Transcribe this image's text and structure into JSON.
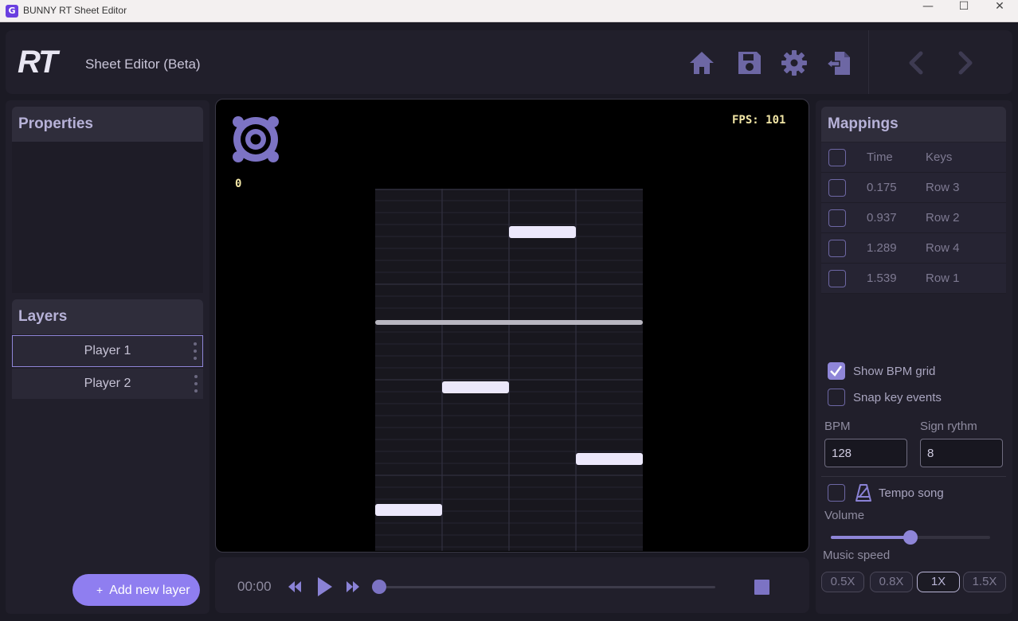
{
  "window": {
    "title": "BUNNY RT Sheet Editor",
    "icon_glyph": "G",
    "controls": {
      "minimize": "—",
      "maximize": "☐",
      "close": "✕"
    }
  },
  "header": {
    "logo": "RT",
    "subtitle": "Sheet Editor (Beta)",
    "icons": [
      "home-icon",
      "save-icon",
      "gear-icon",
      "export-icon",
      "undo-icon",
      "redo-icon"
    ],
    "accent": "#6d67a4"
  },
  "properties": {
    "title": "Properties"
  },
  "layers": {
    "title": "Layers",
    "items": [
      {
        "label": "Player 1",
        "selected": true
      },
      {
        "label": "Player 2",
        "selected": false
      }
    ],
    "add_label": "Add new layer",
    "add_icon": "+"
  },
  "canvas": {
    "fps_label": "FPS: 101",
    "score": "0",
    "lane_count": 4,
    "notes": [
      {
        "time": 0.175,
        "row": 3
      },
      {
        "time": 0.937,
        "row": 2
      },
      {
        "time": 1.289,
        "row": 4
      },
      {
        "time": 1.539,
        "row": 1
      }
    ]
  },
  "transport": {
    "time": "00:00",
    "progress": 0
  },
  "mappings": {
    "title": "Mappings",
    "col_time": "Time",
    "col_keys": "Keys",
    "rows": [
      {
        "time": "0.175",
        "keys": "Row 3"
      },
      {
        "time": "0.937",
        "keys": "Row 2"
      },
      {
        "time": "1.289",
        "keys": "Row 4"
      },
      {
        "time": "1.539",
        "keys": "Row 1"
      }
    ]
  },
  "settings": {
    "show_bpm_grid": {
      "label": "Show BPM grid",
      "checked": true
    },
    "snap_key_events": {
      "label": "Snap key events",
      "checked": false
    },
    "bpm": {
      "label": "BPM",
      "value": "128"
    },
    "sign_rythm": {
      "label": "Sign rythm",
      "value": "8"
    },
    "tempo_song": {
      "label": "Tempo song",
      "checked": false
    },
    "volume": {
      "label": "Volume",
      "level": 0.5
    },
    "music_speed": {
      "label": "Music speed",
      "options": [
        "0.5X",
        "0.8X",
        "1X",
        "1.5X"
      ],
      "selected": "1X"
    }
  }
}
